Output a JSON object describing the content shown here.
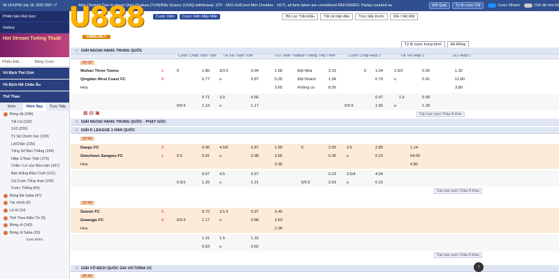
{
  "topbar": {
    "clock": "06:18:53PM July 18, 2025 GMT +7",
    "ticker": "Athn (Tennis) Due to player [Aziz Ouakaa (TUN)/Billy Suarez (USA)] withdrawal. (ITF - M15 HolCrest Men Doubles - 16/7), all bets taken are considered REFUNDED. Parlay counted as",
    "refresh_label": "Kết Quả",
    "odds_type_label": "Tỷ lệ cược CN",
    "quick_bet_label": "Cược Nhanh",
    "one_dollar_label": "Chế độ nền tối"
  },
  "brand": {
    "logo": "U888",
    "sub": "U888.NET"
  },
  "sidebar": {
    "promo": "Phiên bản Rút Gọn",
    "galaxy": "Galaxy",
    "stream": "Hot Stream Tường Thuật",
    "search_a": "Phiếu Đặt...",
    "search_b": "Bảng Cược",
    "world_cup": "Vô Địch Thế Giới",
    "asian_cup": "Vô Địch Nữ Châu Âu",
    "sports": "Thể Thao",
    "tabs": [
      "Sớm",
      "Hôm Nay",
      "Trực Tiếp"
    ],
    "items": [
      {
        "label": "Bóng đá (246)",
        "sub": false
      },
      {
        "label": "Tất Cả (192)",
        "sub": true
      },
      {
        "label": "1X2 (220)",
        "sub": true
      },
      {
        "label": "Tỷ Số Chính Xác (199)",
        "sub": true
      },
      {
        "label": "Lẻ/Chẵn (225)",
        "sub": true
      },
      {
        "label": "Tổng Số Bàn Thắng (194)",
        "sub": true
      },
      {
        "label": "Hiệp 1/Toàn Trận (175)",
        "sub": true
      },
      {
        "label": "Chẵn / Lẻ của Nửa trận (167)",
        "sub": true
      },
      {
        "label": "Bàn thắng Đầu/ Cuối (121)",
        "sub": true
      },
      {
        "label": "Cá Cược Tổng Hợp (109)",
        "sub": true
      },
      {
        "label": "Cược Thắng (64)",
        "sub": true
      },
      {
        "label": "Bóng Đá Saba (47)",
        "sub": false
      },
      {
        "label": "Tài chính (6)",
        "sub": false
      },
      {
        "label": "Lô tô (10)",
        "sub": false
      },
      {
        "label": "Thể Thao Điện Tử (9)",
        "sub": false
      },
      {
        "label": "Bóng rổ (143)",
        "sub": false
      },
      {
        "label": "Bóng rổ Saba (20)",
        "sub": false
      }
    ],
    "show_more": "Xem thêm"
  },
  "filters": {
    "pills": [
      "Cược Xiên",
      "Cược Xiên Mấy Mắn"
    ],
    "sort": "Bộ Lọc Trận Đấu",
    "all_leagues": "Tất cả trận đấu",
    "pre_game": "Trực tiếp trước",
    "count": "(64 / 64) Đội",
    "odds_format": "Tỷ lệ cược trung bình",
    "view": "Hệ Đông"
  },
  "columns": [
    "Cược Chấp Toàn Trận",
    "Tài Xỉu Toàn Trận",
    "1X2 Toàn Trận",
    "Bàn Thắng Tiếp Theo",
    "Cược Chấp Hiệp 1",
    "Tài Xỉu Hiệp 1",
    "1X2 Hiệp 1"
  ],
  "leagues": [
    {
      "name": "GIẢI NGOẠI HẠNG TRUNG QUỐC"
    },
    {
      "name": "GIẢI NGOẠI HẠNG TRUNG QUỐC - PHẠT GÓC"
    },
    {
      "name": "GIẢI K LEAGUE 1 HÀN QUỐC"
    },
    {
      "name": "GIẢI VÔ ĐỊCH QUỐC GIA VICTORIA ÚC"
    }
  ],
  "match1": {
    "time": "1H 18'",
    "home": "Wuhan Three Towns",
    "home_score": "1",
    "away": "Qingdao West Coast FC",
    "away_score": "0",
    "draw": "Hòa",
    "r1": [
      "0",
      "1.86",
      "3/3.5",
      "0.94",
      "1.58",
      "Đội Nhà",
      "2.15",
      "0",
      "1.04",
      "1.5/2",
      "0.90",
      "1.32"
    ],
    "r2": [
      "0.77",
      "u",
      "0.87",
      "5.20",
      "Đội Khách",
      "1.94",
      "0.79",
      "u",
      "0.91",
      "12.80"
    ],
    "r3": [
      "3.65",
      "Không có",
      "8.50",
      "3.80"
    ],
    "r4": [
      "0.71",
      "3.0",
      "0.66",
      "0.47",
      "1.5",
      "0.58"
    ],
    "r5": [
      "0/0.5",
      "1.13",
      "u",
      "1.17",
      "0/0.5",
      "1.56",
      "u",
      "1.29"
    ]
  },
  "match2": {
    "time": "1H 46'",
    "home": "Daegu FC",
    "home_score": "2",
    "away": "Gimcheon Sangmu FC",
    "away_score": "1",
    "draw": "Hòa",
    "r1": [
      "0.96",
      "4.5/5",
      "0.87",
      "1.99",
      "0",
      "2.00",
      "3.5",
      "2.85",
      "1.14"
    ],
    "r2": [
      "0.5",
      "0.91",
      "u",
      "0.98",
      "3.65",
      "0.35",
      "u",
      "0.23",
      "64.00"
    ],
    "r3": [
      "3.30",
      "4.80"
    ],
    "r4": [
      "0.67",
      "4.5",
      "0.67",
      "0.23",
      "3.5/4",
      "4.54"
    ],
    "r5": [
      "0.5/1",
      "1.25",
      "u",
      "1.21",
      "0/0.5",
      "2.63",
      "u",
      "0.10"
    ]
  },
  "match3": {
    "time": "1H 44'",
    "home": "Suwon FC",
    "home_score": "0",
    "away": "Gwangju FC",
    "away_score": "0",
    "draw": "Hòa",
    "r1": [
      "0.72",
      "1/1.5",
      "0.97",
      "3.45"
    ],
    "r2": [
      "0/0.5",
      "1.17",
      "u",
      "0.88",
      "2.63"
    ],
    "r3": [
      "2.38"
    ],
    "r4": [
      "1.31",
      "1.5",
      "1.33"
    ],
    "r5": [
      "0.63",
      "u",
      "0.60"
    ]
  },
  "more_bets": "Các loại cược Châu Á khác",
  "match4_time": "2H 40'"
}
